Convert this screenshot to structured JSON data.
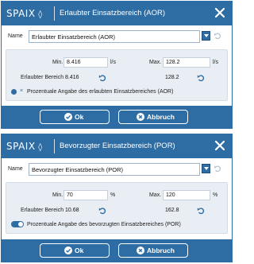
{
  "dialog_aor": {
    "logo": "SPAIX",
    "title": "Erlaubter Einsatzbereich (AOR)",
    "name_label": "Name",
    "name_value": "Erlaubter Einsatzbereich (AOR)",
    "min_label": "Min.",
    "min_value": "8.416",
    "min_unit": "l/s",
    "max_label": "Max.",
    "max_value": "128.2",
    "max_unit": "l/s",
    "allowed_label": "Erlaubter Bereich",
    "allowed_min": "8.416",
    "allowed_max": "128.2",
    "percent_mark": "×",
    "percent_text": "Prozentuale Angabe des erlaubten Einsatzbereiches (AOR)",
    "ok_label": "Ok",
    "cancel_label": "Abbruch"
  },
  "dialog_por": {
    "logo": "SPAIX",
    "title": "Bevorzugter Einsatzbereich (POR)",
    "name_label": "Name",
    "name_value": "Bevorzugter Einsatzbereich (POR)",
    "min_label": "Min.",
    "min_value": "70",
    "min_unit": "%",
    "max_label": "Max.",
    "max_value": "120",
    "max_unit": "%",
    "allowed_label": "Erlaubter Bereich",
    "allowed_min": "10.68",
    "allowed_max": "162.8",
    "percent_toggle_on": true,
    "percent_text": "Prozentuale Angabe des bevorzugten Einsatzbereiches (POR)",
    "ok_label": "Ok",
    "cancel_label": "Abbruch"
  },
  "colors": {
    "brand_blue": "#2e6ca4",
    "panel_bg": "#e9eef4"
  },
  "icons": [
    "close-icon",
    "chevron-down-icon",
    "undo-icon",
    "check-circle-icon",
    "cancel-circle-icon"
  ]
}
